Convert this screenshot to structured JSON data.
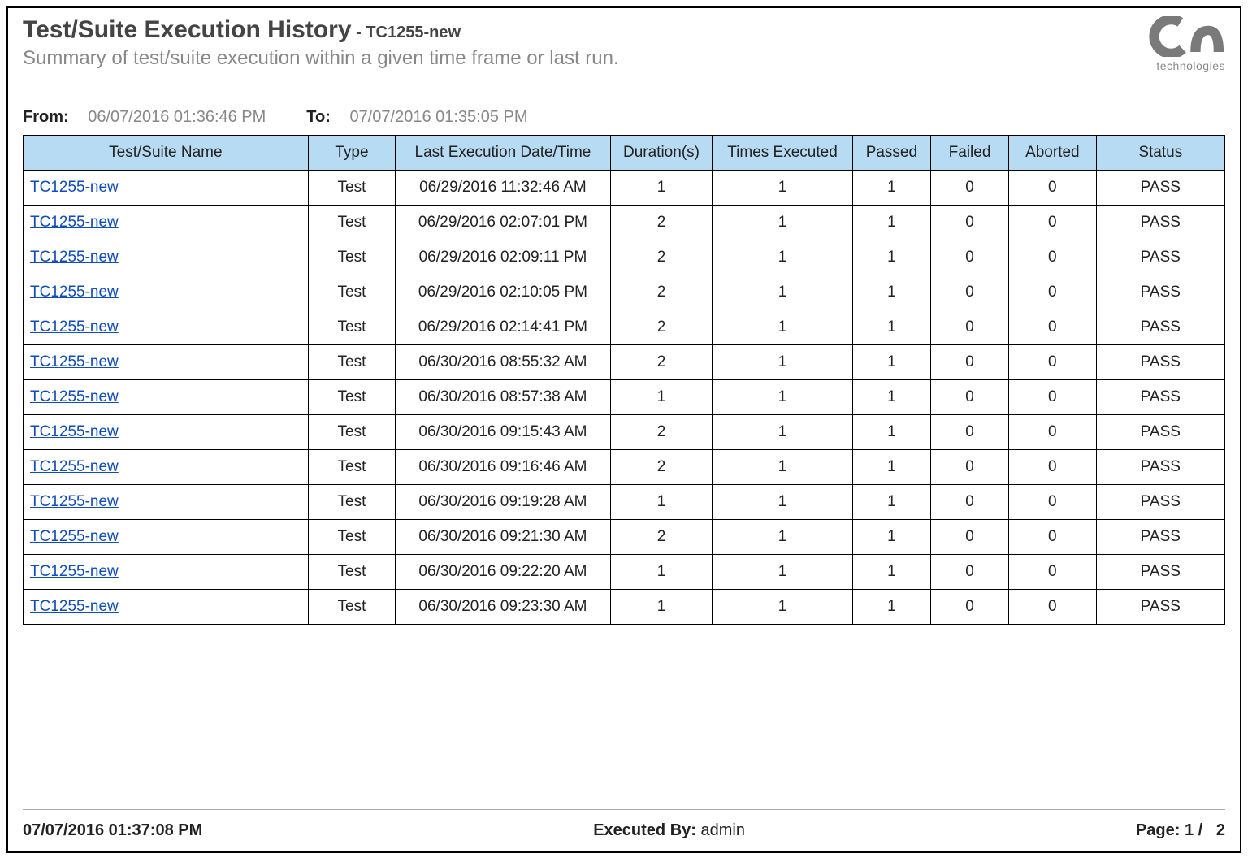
{
  "header": {
    "title": "Test/Suite Execution History",
    "title_suffix_sep": " - ",
    "title_suffix": "TC1255-new",
    "subtitle": "Summary of test/suite execution within a given time frame or last run.",
    "logo_caption": "technologies"
  },
  "filters": {
    "from_label": "From:",
    "from_value": "06/07/2016 01:36:46 PM",
    "to_label": "To:",
    "to_value": "07/07/2016 01:35:05 PM"
  },
  "table": {
    "headers": {
      "name": "Test/Suite Name",
      "type": "Type",
      "last_exec": "Last Execution Date/Time",
      "duration": "Duration(s)",
      "times": "Times Executed",
      "passed": "Passed",
      "failed": "Failed",
      "aborted": "Aborted",
      "status": "Status"
    },
    "rows": [
      {
        "name": "TC1255-new",
        "type": "Test",
        "last_exec": "06/29/2016 11:32:46 AM",
        "duration": "1",
        "times": "1",
        "passed": "1",
        "failed": "0",
        "aborted": "0",
        "status": "PASS"
      },
      {
        "name": "TC1255-new",
        "type": "Test",
        "last_exec": "06/29/2016 02:07:01 PM",
        "duration": "2",
        "times": "1",
        "passed": "1",
        "failed": "0",
        "aborted": "0",
        "status": "PASS"
      },
      {
        "name": "TC1255-new",
        "type": "Test",
        "last_exec": "06/29/2016 02:09:11 PM",
        "duration": "2",
        "times": "1",
        "passed": "1",
        "failed": "0",
        "aborted": "0",
        "status": "PASS"
      },
      {
        "name": "TC1255-new",
        "type": "Test",
        "last_exec": "06/29/2016 02:10:05 PM",
        "duration": "2",
        "times": "1",
        "passed": "1",
        "failed": "0",
        "aborted": "0",
        "status": "PASS"
      },
      {
        "name": "TC1255-new",
        "type": "Test",
        "last_exec": "06/29/2016 02:14:41 PM",
        "duration": "2",
        "times": "1",
        "passed": "1",
        "failed": "0",
        "aborted": "0",
        "status": "PASS"
      },
      {
        "name": "TC1255-new",
        "type": "Test",
        "last_exec": "06/30/2016 08:55:32 AM",
        "duration": "2",
        "times": "1",
        "passed": "1",
        "failed": "0",
        "aborted": "0",
        "status": "PASS"
      },
      {
        "name": "TC1255-new",
        "type": "Test",
        "last_exec": "06/30/2016 08:57:38 AM",
        "duration": "1",
        "times": "1",
        "passed": "1",
        "failed": "0",
        "aborted": "0",
        "status": "PASS"
      },
      {
        "name": "TC1255-new",
        "type": "Test",
        "last_exec": "06/30/2016 09:15:43 AM",
        "duration": "2",
        "times": "1",
        "passed": "1",
        "failed": "0",
        "aborted": "0",
        "status": "PASS"
      },
      {
        "name": "TC1255-new",
        "type": "Test",
        "last_exec": "06/30/2016 09:16:46 AM",
        "duration": "2",
        "times": "1",
        "passed": "1",
        "failed": "0",
        "aborted": "0",
        "status": "PASS"
      },
      {
        "name": "TC1255-new",
        "type": "Test",
        "last_exec": "06/30/2016 09:19:28 AM",
        "duration": "1",
        "times": "1",
        "passed": "1",
        "failed": "0",
        "aborted": "0",
        "status": "PASS"
      },
      {
        "name": "TC1255-new",
        "type": "Test",
        "last_exec": "06/30/2016 09:21:30 AM",
        "duration": "2",
        "times": "1",
        "passed": "1",
        "failed": "0",
        "aborted": "0",
        "status": "PASS"
      },
      {
        "name": "TC1255-new",
        "type": "Test",
        "last_exec": "06/30/2016 09:22:20 AM",
        "duration": "1",
        "times": "1",
        "passed": "1",
        "failed": "0",
        "aborted": "0",
        "status": "PASS"
      },
      {
        "name": "TC1255-new",
        "type": "Test",
        "last_exec": "06/30/2016 09:23:30 AM",
        "duration": "1",
        "times": "1",
        "passed": "1",
        "failed": "0",
        "aborted": "0",
        "status": "PASS"
      }
    ]
  },
  "footer": {
    "timestamp": "07/07/2016 01:37:08 PM",
    "executed_by_label": "Executed By:",
    "executed_by_value": "admin",
    "page_label": "Page: 1 /",
    "page_total": "2"
  }
}
